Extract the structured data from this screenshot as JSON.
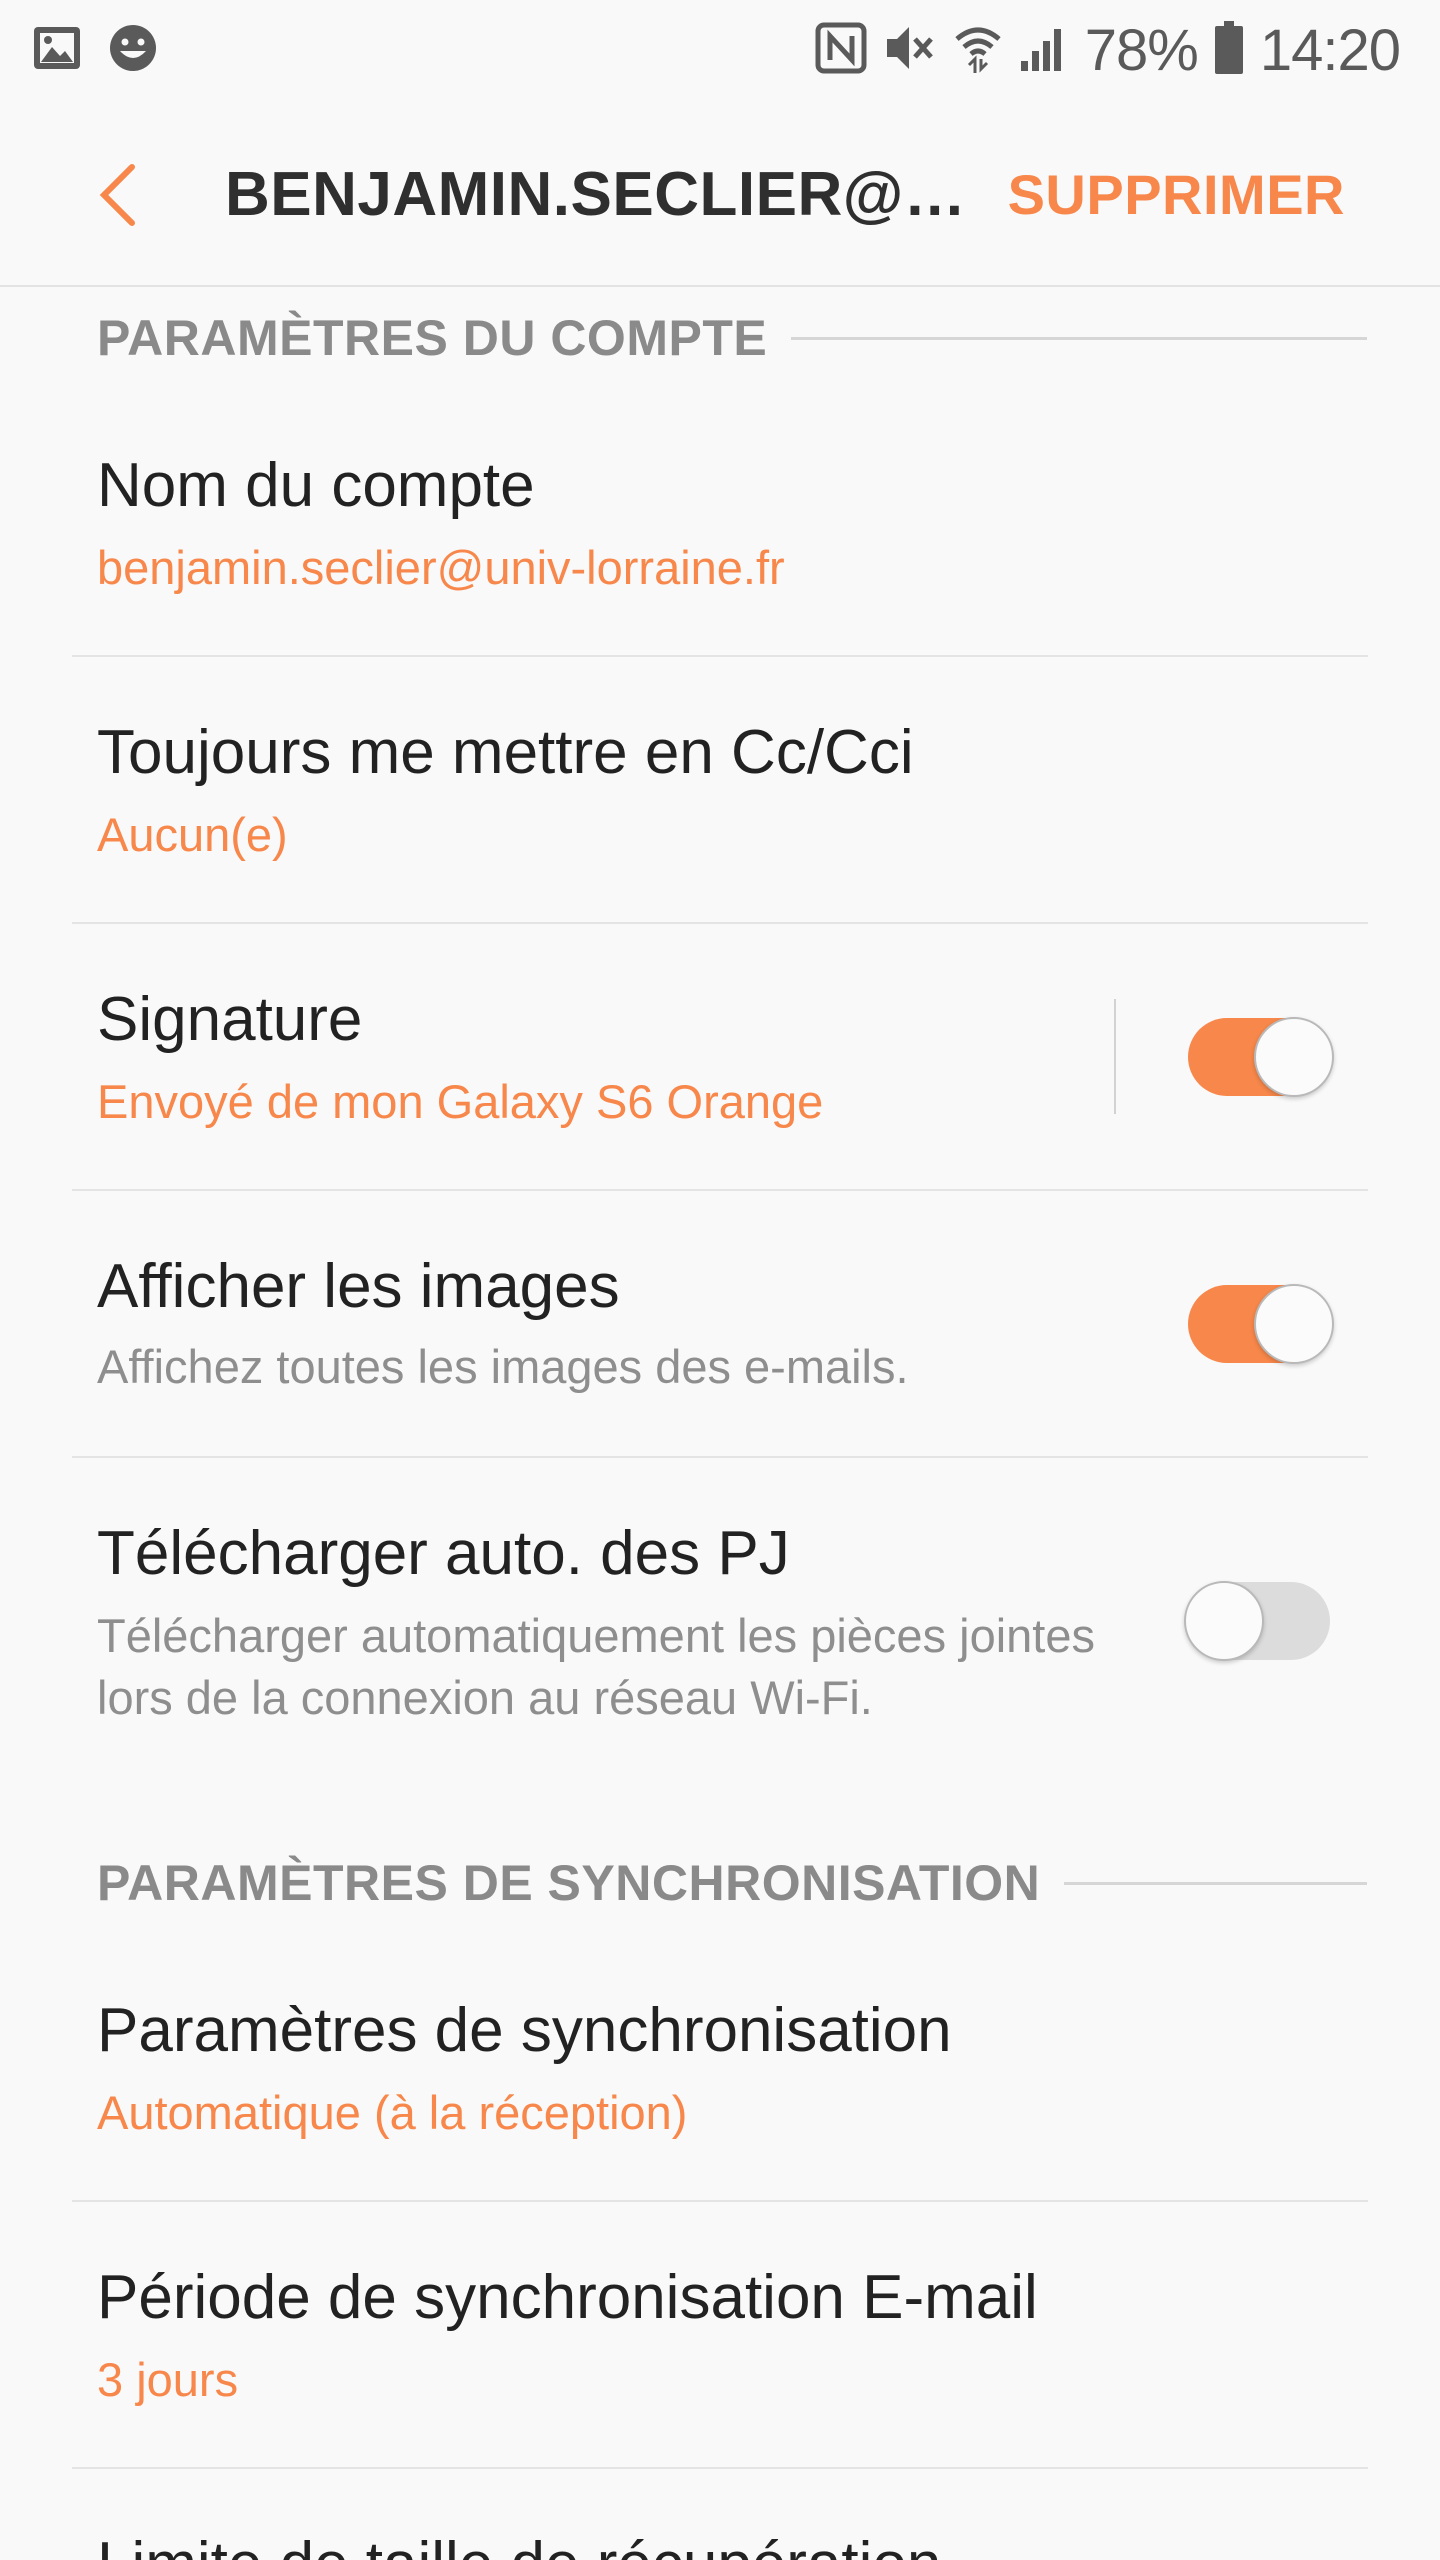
{
  "status_bar": {
    "icons_left": [
      "image-icon",
      "smiley-icon"
    ],
    "icons_right": [
      "nfc-icon",
      "mute-icon",
      "wifi-icon",
      "signal-icon",
      "battery-icon"
    ],
    "battery": "78%",
    "time": "14:20"
  },
  "app_bar": {
    "title": "BENJAMIN.SECLIER@UNIV…",
    "delete_label": "SUPPRIMER",
    "back_icon": "chevron-left-icon"
  },
  "colors": {
    "accent": "#f7874a",
    "background": "#f9f9f9",
    "toggle_off_track": "#dcdcdc"
  },
  "sections": {
    "account": {
      "header": "PARAMÈTRES DU COMPTE",
      "items": [
        {
          "title": "Nom du compte",
          "subtitle": "benjamin.seclier@univ-lorraine.fr"
        },
        {
          "title": "Toujours me mettre en Cc/Cci",
          "subtitle": "Aucun(e)"
        },
        {
          "title": "Signature",
          "subtitle": "Envoyé de mon Galaxy S6 Orange",
          "toggle": true
        },
        {
          "title": "Afficher les images",
          "subtitle": "Affichez toutes les images des e-mails.",
          "toggle": true
        },
        {
          "title": "Télécharger auto. des PJ",
          "subtitle": "Télécharger automatiquement les pièces jointes lors de la connexion au réseau Wi-Fi.",
          "toggle": false
        }
      ]
    },
    "sync": {
      "header": "PARAMÈTRES DE SYNCHRONISATION",
      "items": [
        {
          "title": "Paramètres de synchronisation",
          "subtitle": "Automatique (à la réception)"
        },
        {
          "title": "Période de synchronisation E-mail",
          "subtitle": "3 jours"
        },
        {
          "title": "Limite de taille de récupération"
        }
      ]
    }
  }
}
